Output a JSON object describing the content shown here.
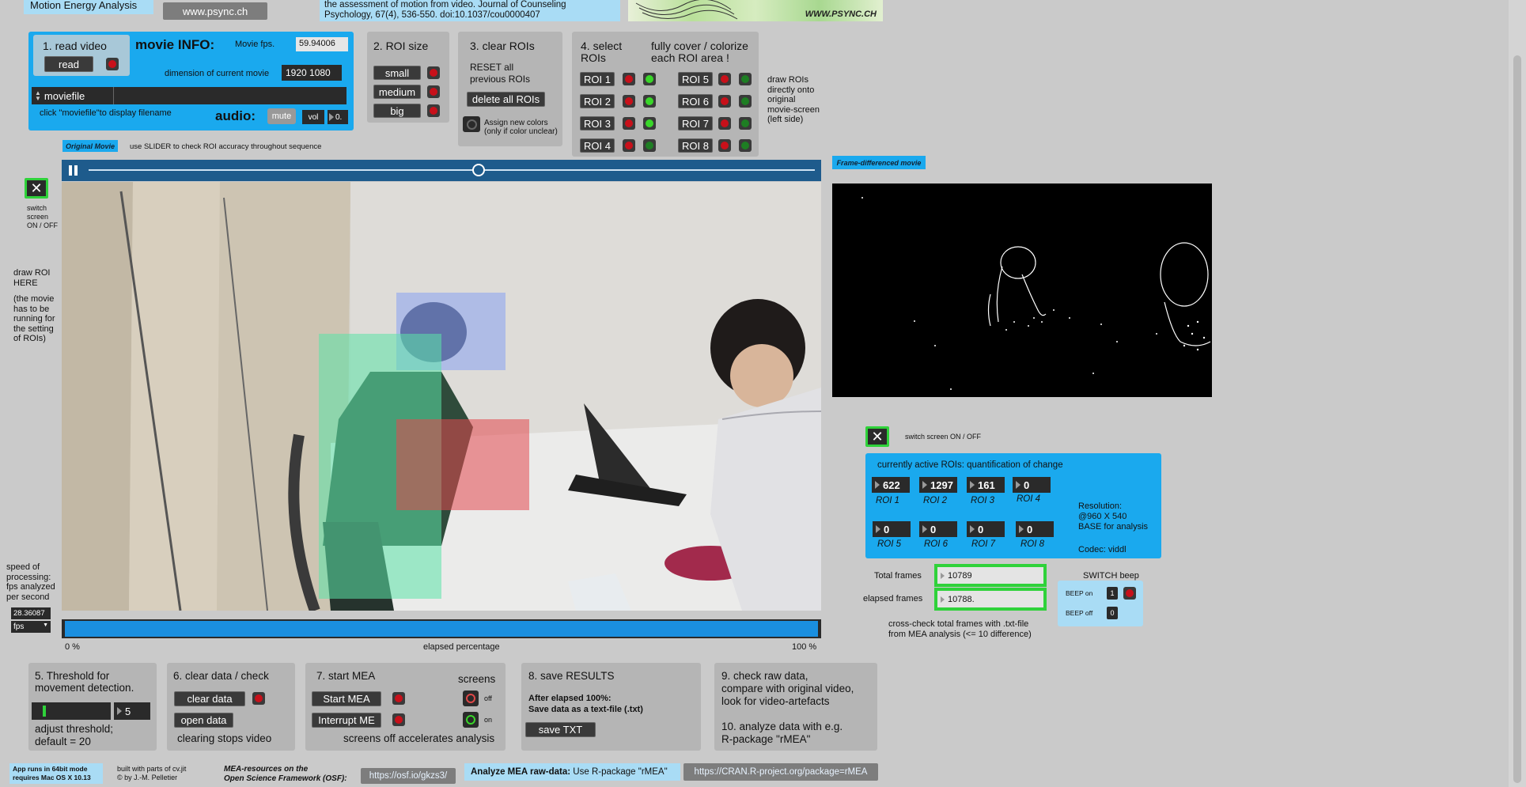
{
  "header": {
    "app_title": "Motion Energy Analysis",
    "website_btn": "www.psync.ch",
    "citation": "the assessment of motion from video. Journal of Counseling Psychology, 67(4), 536-550. doi:10.1037/cou0000407",
    "logo_text": "WWW.PSYNC.CH"
  },
  "movie_info": {
    "read_title": "1. read video",
    "read_btn": "read",
    "info_title": "movie INFO:",
    "fps_label": "Movie fps.",
    "fps_value": "59.94006",
    "dim_label": "dimension of current movie",
    "dim_value": "1920 1080",
    "moviefile": "moviefile",
    "hint": "click \"moviefile\"to display  filename",
    "audio_label": "audio:",
    "mute_btn": "mute",
    "vol_label": "vol",
    "vol_value": "0."
  },
  "roi_size": {
    "title": "2. ROI size",
    "small": "small",
    "medium": "medium",
    "big": "big"
  },
  "clear_rois": {
    "title": "3. clear ROIs",
    "desc1": "RESET all",
    "desc2": "previous ROIs",
    "delete_btn": "delete all ROIs",
    "assign1": "Assign new colors",
    "assign2": "(only if color unclear)"
  },
  "select_rois": {
    "title1": "4. select",
    "title2": "ROIs",
    "hint1": "fully cover / colorize",
    "hint2": "each ROI area !",
    "rois": [
      "ROI 1",
      "ROI 2",
      "ROI 3",
      "ROI 4",
      "ROI 5",
      "ROI 6",
      "ROI 7",
      "ROI 8"
    ]
  },
  "draw_hint": [
    "draw ROIs",
    "directly onto",
    "original",
    "movie-screen",
    "(left side)"
  ],
  "original_movie_label": "Original Movie",
  "slider_hint": "use SLIDER to check ROI accuracy throughout sequence",
  "frame_diff_label": "Frame-differenced movie",
  "switch_screen_left": [
    "switch",
    "screen",
    "ON / OFF"
  ],
  "draw_roi_here": [
    "draw ROI",
    "HERE",
    "",
    "(the movie",
    "has to be",
    "running for",
    "the setting",
    "of ROIs)"
  ],
  "speed": {
    "label": [
      "speed of",
      "processing:",
      "fps analyzed",
      "per second"
    ],
    "value": "28.36087",
    "unit": "fps"
  },
  "progress": {
    "left": "0 %",
    "center": "elapsed percentage",
    "right": "100 %",
    "fraction": 1.0
  },
  "switch_screen_right": "switch screen ON / OFF",
  "quant": {
    "title": "currently active ROIs: quantification of change",
    "values": [
      "622",
      "1297",
      "161",
      "0",
      "0",
      "0",
      "0",
      "0"
    ],
    "labels": [
      "ROI 1",
      "ROI 2",
      "ROI 3",
      "ROI 4",
      "ROI 5",
      "ROI 6",
      "ROI 7",
      "ROI 8"
    ],
    "resolution1": "Resolution:",
    "resolution2": "@960 X 540",
    "resolution3": "BASE for analysis",
    "codec": "Codec: viddl"
  },
  "frames": {
    "total_label": "Total frames",
    "total_value": "10789",
    "elapsed_label": "elapsed frames",
    "elapsed_value": "10788.",
    "note1": "cross-check total frames with .txt-file",
    "note2": "from MEA analysis (<= 10 difference)"
  },
  "beep": {
    "title": "SWITCH beep",
    "on_label": "BEEP  on",
    "on_value": "1",
    "off_label": "BEEP  off",
    "off_value": "0"
  },
  "threshold": {
    "title1": "5. Threshold for",
    "title2": "movement detection.",
    "value": "5",
    "level": 0.05,
    "hint1": "adjust threshold;",
    "hint2": "default = 20"
  },
  "clear_data": {
    "title": "6. clear data / check",
    "clear_btn": "clear data",
    "open_btn": "open data",
    "hint": "clearing stops video"
  },
  "start_mea": {
    "title": "7. start MEA",
    "screens": "screens",
    "start_btn": "Start MEA",
    "interrupt_btn": "Interrupt ME",
    "off": "off",
    "on": "on",
    "hint": "screens off accelerates analysis"
  },
  "save": {
    "title": "8. save RESULTS",
    "hint1": "After elapsed 100%:",
    "hint2": "Save data as a text-file (.txt)",
    "btn": "save TXT"
  },
  "check": {
    "line1": "9. check raw data,",
    "line2": "compare with original video,",
    "line3": "look for video-artefacts",
    "line4": "10. analyze data with e.g.",
    "line5": "R-package \"rMEA\""
  },
  "footer": {
    "app64_1": "App runs in 64bit  mode",
    "app64_2": "requires Mac OS X 10.13",
    "built1": "built with parts of cv.jit",
    "built2": "© by J.-M. Pelletier",
    "osf1": "MEA-resources on the",
    "osf2": "Open Science Framework (OSF):",
    "osf_link": "https://osf.io/gkzs3/",
    "rmea_bold": "Analyze MEA raw-data:",
    "rmea_text": " Use R-package \"rMEA\"",
    "cran_link": "https://CRAN.R-project.org/package=rMEA"
  }
}
